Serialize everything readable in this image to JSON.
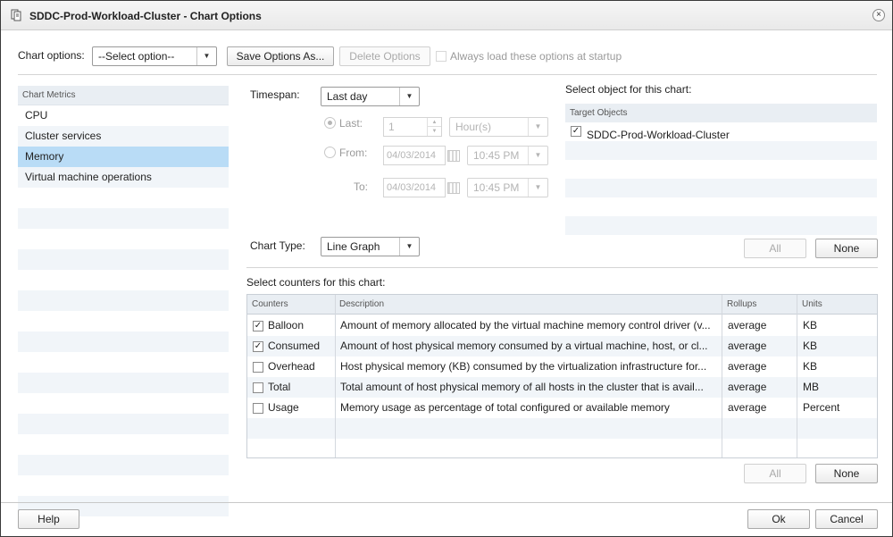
{
  "window": {
    "title": "SDDC-Prod-Workload-Cluster - Chart Options",
    "close_symbol": "×"
  },
  "toolbar": {
    "chart_options_label": "Chart options:",
    "chart_options_value": "--Select option--",
    "save_as_label": "Save Options As...",
    "delete_label": "Delete Options",
    "always_load_label": "Always load these options at startup"
  },
  "metrics": {
    "header": "Chart Metrics",
    "items": [
      "CPU",
      "Cluster services",
      "Memory",
      "Virtual machine operations"
    ],
    "selected": "Memory"
  },
  "timespan": {
    "label": "Timespan:",
    "value": "Last day",
    "last_label": "Last:",
    "last_value": "1",
    "last_unit": "Hour(s)",
    "from_label": "From:",
    "from_date": "04/03/2014",
    "from_time": "10:45 PM",
    "to_label": "To:",
    "to_date": "04/03/2014",
    "to_time": "10:45 PM"
  },
  "chart_type": {
    "label": "Chart Type:",
    "value": "Line Graph"
  },
  "objects": {
    "title": "Select object for this chart:",
    "header": "Target Objects",
    "items": [
      {
        "name": "SDDC-Prod-Workload-Cluster",
        "checked": true
      }
    ],
    "all_label": "All",
    "none_label": "None"
  },
  "counters": {
    "title": "Select counters for this chart:",
    "headers": {
      "counters": "Counters",
      "description": "Description",
      "rollups": "Rollups",
      "units": "Units"
    },
    "rows": [
      {
        "name": "Balloon",
        "checked": true,
        "description": "Amount of memory allocated by the virtual machine memory control driver (v...",
        "rollup": "average",
        "unit": "KB"
      },
      {
        "name": "Consumed",
        "checked": true,
        "description": "Amount of host physical memory consumed by a virtual machine, host, or cl...",
        "rollup": "average",
        "unit": "KB"
      },
      {
        "name": "Overhead",
        "checked": false,
        "description": "Host physical memory (KB) consumed by the virtualization infrastructure for...",
        "rollup": "average",
        "unit": "KB"
      },
      {
        "name": "Total",
        "checked": false,
        "description": "Total amount of host physical memory of all hosts in the cluster that is avail...",
        "rollup": "average",
        "unit": "MB"
      },
      {
        "name": "Usage",
        "checked": false,
        "description": "Memory usage as percentage of total configured or available memory",
        "rollup": "average",
        "unit": "Percent"
      }
    ],
    "all_label": "All",
    "none_label": "None"
  },
  "footer": {
    "help_label": "Help",
    "ok_label": "Ok",
    "cancel_label": "Cancel"
  },
  "glyphs": {
    "check": "✓",
    "dropdown": "▼",
    "spin_up": "▲",
    "spin_down": "▼"
  }
}
